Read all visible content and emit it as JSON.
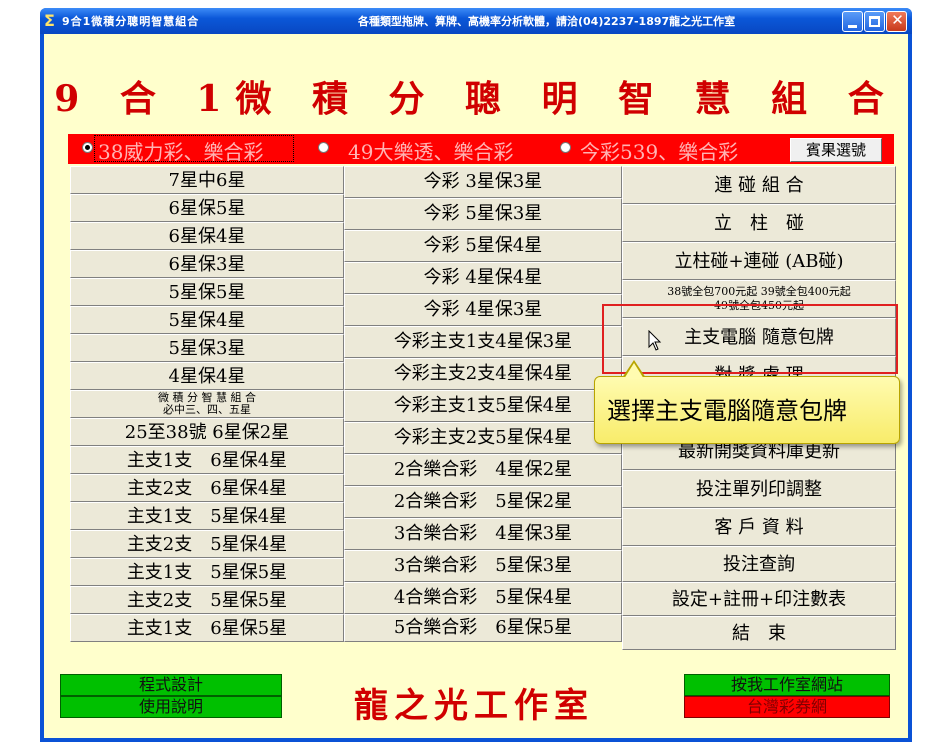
{
  "window": {
    "title": "9合1微積分聰明智慧組合",
    "info": "各種類型拖牌、算牌、高機率分析軟體，請洽(04)2237-1897龍之光工作室",
    "app_icon": "sigma-icon"
  },
  "heading": "9 合 1微 積 分 聰 明 智 慧 組 合",
  "options": [
    {
      "label": "38威力彩、樂合彩",
      "selected": true
    },
    {
      "label": "49大樂透、樂合彩",
      "selected": false
    },
    {
      "label": "今彩539、樂合彩",
      "selected": false
    }
  ],
  "result_button": "賓果選號",
  "column_a": [
    "7星中6星",
    "6星保5星",
    "6星保4星",
    "6星保3星",
    "5星保5星",
    "5星保4星",
    "5星保3星",
    "4星保4星",
    "微 積 分 智 慧 組 合",
    "必中三、四、五星",
    "25至38號 6星保2星",
    "主支1支　6星保4星",
    "主支2支　6星保4星",
    "主支1支　5星保4星",
    "主支2支　5星保4星",
    "主支1支　5星保5星",
    "主支2支　5星保5星",
    "主支1支　6星保5星"
  ],
  "column_b": [
    "今彩 3星保3星",
    "今彩 5星保3星",
    "今彩 5星保4星",
    "今彩 4星保4星",
    "今彩 4星保3星",
    "今彩主支1支4星保3星",
    "今彩主支2支4星保4星",
    "今彩主支1支5星保4星",
    "今彩主支2支5星保4星",
    "2合樂合彩　4星保2星",
    "2合樂合彩　5星保2星",
    "3合樂合彩　4星保3星",
    "3合樂合彩　5星保3星",
    "4合樂合彩　5星保4星",
    "5合樂合彩　6星保5星"
  ],
  "column_c": [
    "連 碰 組 合",
    "立　柱　碰",
    "立柱碰+連碰 (AB碰)",
    "38號全包700元起 39號全包400元起",
    "49號全包450元起",
    "主支電腦 隨意包牌",
    "對 獎 處 理",
    "最新開獎資料庫更新",
    "投注單列印調整",
    "客 戶 資 料",
    "投注查詢",
    "設定+註冊+印注數表",
    "結　束"
  ],
  "bottom": {
    "design": "程式設計",
    "manual": "使用說明",
    "brand": "龍之光工作室",
    "website": "按我工作室網站",
    "lottery_site": "台灣彩券網"
  },
  "tooltip": "選擇主支電腦隨意包牌",
  "colors": {
    "title_red": "#d00000",
    "option_bar": "#ff0000",
    "bg": "#ffffcc",
    "green": "#00c000"
  }
}
